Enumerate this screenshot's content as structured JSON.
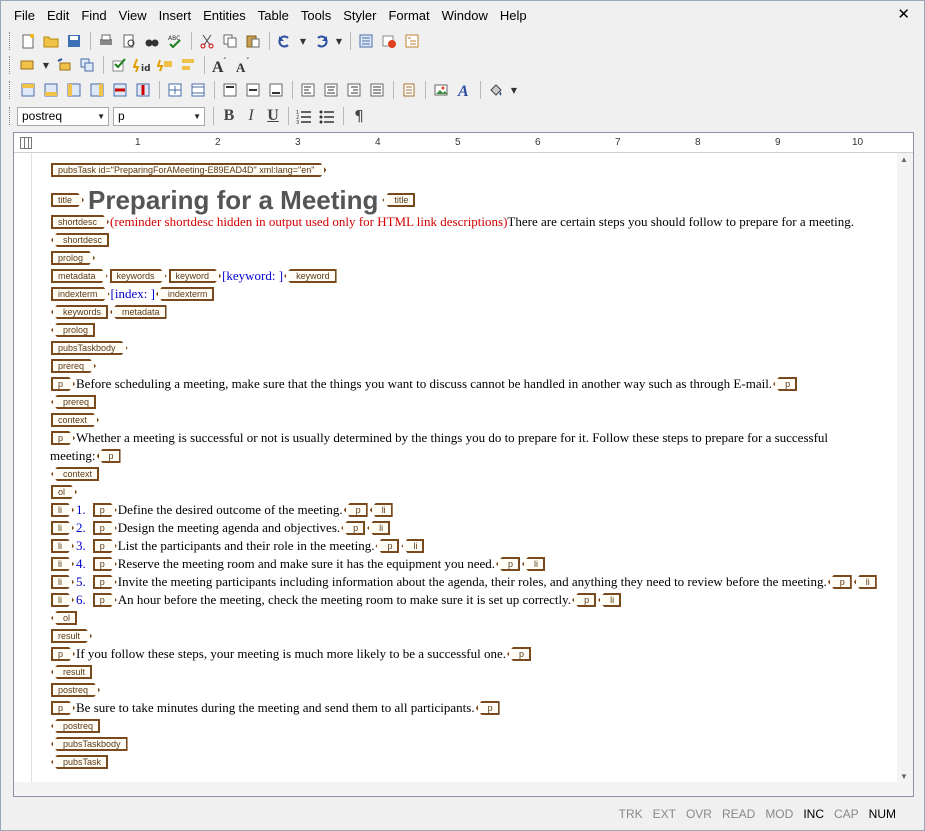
{
  "menu": [
    "File",
    "Edit",
    "Find",
    "View",
    "Insert",
    "Entities",
    "Table",
    "Tools",
    "Styler",
    "Format",
    "Window",
    "Help"
  ],
  "window": {
    "close_glyph": "✕"
  },
  "format_bar": {
    "element_combo": "postreq",
    "style_combo": "p",
    "bold": "B",
    "italic": "I",
    "underline": "U",
    "pilcrow": "¶"
  },
  "ruler": {
    "numbers": [
      "1",
      "2",
      "3",
      "4",
      "5",
      "6",
      "7",
      "8",
      "9",
      "10"
    ]
  },
  "document": {
    "pubsTask_tag": "pubsTask id=\"PreparingForAMeeting-E89EAD4D\" xml:lang=\"en\"",
    "title_text": "Preparing for a Meeting",
    "shortdesc_note": "(reminder shortdesc hidden in output used only for HTML link descriptions)",
    "shortdesc_text": "There are certain steps you should follow to prepare for a meeting.",
    "keyword_text": "[keyword: ]",
    "index_text": "[index: ]",
    "prereq_p": "Before scheduling a meeting, make sure that the things you want to discuss cannot be handled in another way such as through E-mail.",
    "context_p1": "Whether a meeting is successful or not is usually determined by the things you do to prepare for it. Follow these steps to prepare for a successful",
    "context_p2": "meeting:",
    "steps": [
      {
        "num": "1.",
        "text": "Define the desired outcome of the meeting."
      },
      {
        "num": "2.",
        "text": "Design the meeting agenda and objectives."
      },
      {
        "num": "3.",
        "text": "List the participants and their role in the meeting."
      },
      {
        "num": "4.",
        "text": "Reserve the meeting room and make sure it has the equipment you need."
      },
      {
        "num": "5.",
        "text": "Invite the meeting participants including information about the agenda, their roles, and anything they need to review before the meeting."
      },
      {
        "num": "6.",
        "text": "An hour before the meeting, check the meeting room to make sure it is set up correctly."
      }
    ],
    "result_p": "If you follow these steps, your meeting is much more likely to be a successful one.",
    "postreq_p": "Be sure to take minutes during the meeting and send them to all participants.",
    "tags": {
      "title": "title",
      "shortdesc": "shortdesc",
      "prolog": "prolog",
      "metadata": "metadata",
      "keywords": "keywords",
      "keyword": "keyword",
      "indexterm": "indexterm",
      "pubsTaskbody": "pubsTaskbody",
      "prereq": "prereq",
      "p": "p",
      "context": "context",
      "ol": "ol",
      "li": "li",
      "result": "result",
      "postreq": "postreq",
      "pubsTask": "pubsTask"
    }
  },
  "status": [
    {
      "label": "TRK",
      "on": false
    },
    {
      "label": "EXT",
      "on": false
    },
    {
      "label": "OVR",
      "on": false
    },
    {
      "label": "READ",
      "on": false
    },
    {
      "label": "MOD",
      "on": false
    },
    {
      "label": "INC",
      "on": true
    },
    {
      "label": "CAP",
      "on": false
    },
    {
      "label": "NUM",
      "on": true
    }
  ]
}
